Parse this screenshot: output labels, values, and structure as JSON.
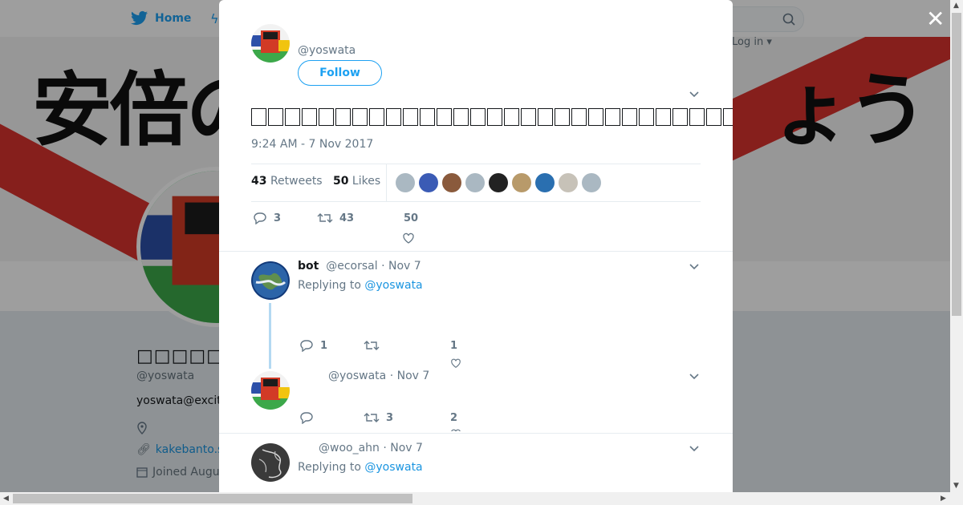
{
  "background": {
    "nav": {
      "home_label": "Home",
      "login_label": "Log in ▾"
    },
    "banner_text_left": "安倍の",
    "banner_text_right": "ょう",
    "profile": {
      "name_label": "□□□□□□□□",
      "handle": "@yoswata",
      "bio": "yoswata@excit",
      "website": "kakebanto.s",
      "joined": "Joined Augu"
    }
  },
  "modal": {
    "author_handle": "@yoswata",
    "follow_label": "Follow",
    "tweet_glyph_count": 52,
    "timestamp": "9:24 AM - 7 Nov 2017",
    "retweets_count": "43",
    "retweets_label": "Retweets",
    "likes_count": "50",
    "likes_label": "Likes",
    "liker_colors": [
      "#aab8c2",
      "#3b5bb5",
      "#8a5a3c",
      "#aab8c2",
      "#222222",
      "#b89a6a",
      "#2a6fb0",
      "#c7c2b8",
      "#aab8c2"
    ],
    "actions": {
      "replies": "3",
      "retweets": "43",
      "likes": "50"
    },
    "replies": [
      {
        "name": "bot",
        "handle": "@ecorsal",
        "date": "· Nov 7",
        "replying_prefix": "Replying to",
        "replying_to": "@yoswata",
        "replies": "1",
        "retweets": "",
        "likes": "1"
      },
      {
        "name": "",
        "handle": "@yoswata",
        "date": "· Nov 7",
        "replies": "",
        "retweets": "3",
        "likes": "2"
      },
      {
        "name": "",
        "handle": "@woo_ahn",
        "date": "· Nov 7",
        "replying_prefix": "Replying to",
        "replying_to": "@yoswata"
      }
    ]
  }
}
